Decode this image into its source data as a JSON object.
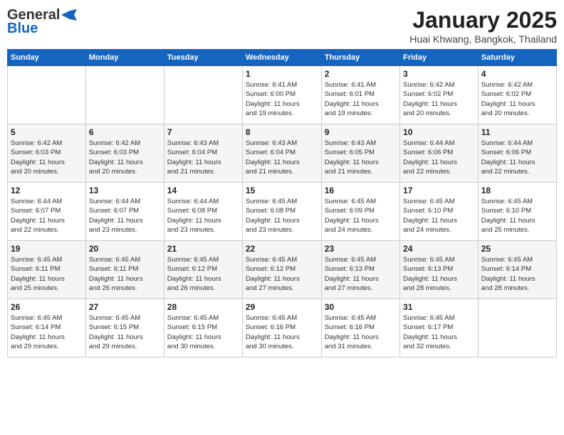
{
  "header": {
    "logo_general": "General",
    "logo_blue": "Blue",
    "title": "January 2025",
    "subtitle": "Huai Khwang, Bangkok, Thailand"
  },
  "weekdays": [
    "Sunday",
    "Monday",
    "Tuesday",
    "Wednesday",
    "Thursday",
    "Friday",
    "Saturday"
  ],
  "weeks": [
    [
      {
        "day": "",
        "info": ""
      },
      {
        "day": "",
        "info": ""
      },
      {
        "day": "",
        "info": ""
      },
      {
        "day": "1",
        "info": "Sunrise: 6:41 AM\nSunset: 6:00 PM\nDaylight: 11 hours\nand 19 minutes."
      },
      {
        "day": "2",
        "info": "Sunrise: 6:41 AM\nSunset: 6:01 PM\nDaylight: 11 hours\nand 19 minutes."
      },
      {
        "day": "3",
        "info": "Sunrise: 6:42 AM\nSunset: 6:02 PM\nDaylight: 11 hours\nand 20 minutes."
      },
      {
        "day": "4",
        "info": "Sunrise: 6:42 AM\nSunset: 6:02 PM\nDaylight: 11 hours\nand 20 minutes."
      }
    ],
    [
      {
        "day": "5",
        "info": "Sunrise: 6:42 AM\nSunset: 6:03 PM\nDaylight: 11 hours\nand 20 minutes."
      },
      {
        "day": "6",
        "info": "Sunrise: 6:42 AM\nSunset: 6:03 PM\nDaylight: 11 hours\nand 20 minutes."
      },
      {
        "day": "7",
        "info": "Sunrise: 6:43 AM\nSunset: 6:04 PM\nDaylight: 11 hours\nand 21 minutes."
      },
      {
        "day": "8",
        "info": "Sunrise: 6:43 AM\nSunset: 6:04 PM\nDaylight: 11 hours\nand 21 minutes."
      },
      {
        "day": "9",
        "info": "Sunrise: 6:43 AM\nSunset: 6:05 PM\nDaylight: 11 hours\nand 21 minutes."
      },
      {
        "day": "10",
        "info": "Sunrise: 6:44 AM\nSunset: 6:06 PM\nDaylight: 11 hours\nand 22 minutes."
      },
      {
        "day": "11",
        "info": "Sunrise: 6:44 AM\nSunset: 6:06 PM\nDaylight: 11 hours\nand 22 minutes."
      }
    ],
    [
      {
        "day": "12",
        "info": "Sunrise: 6:44 AM\nSunset: 6:07 PM\nDaylight: 11 hours\nand 22 minutes."
      },
      {
        "day": "13",
        "info": "Sunrise: 6:44 AM\nSunset: 6:07 PM\nDaylight: 11 hours\nand 23 minutes."
      },
      {
        "day": "14",
        "info": "Sunrise: 6:44 AM\nSunset: 6:08 PM\nDaylight: 11 hours\nand 23 minutes."
      },
      {
        "day": "15",
        "info": "Sunrise: 6:45 AM\nSunset: 6:08 PM\nDaylight: 11 hours\nand 23 minutes."
      },
      {
        "day": "16",
        "info": "Sunrise: 6:45 AM\nSunset: 6:09 PM\nDaylight: 11 hours\nand 24 minutes."
      },
      {
        "day": "17",
        "info": "Sunrise: 6:45 AM\nSunset: 6:10 PM\nDaylight: 11 hours\nand 24 minutes."
      },
      {
        "day": "18",
        "info": "Sunrise: 6:45 AM\nSunset: 6:10 PM\nDaylight: 11 hours\nand 25 minutes."
      }
    ],
    [
      {
        "day": "19",
        "info": "Sunrise: 6:45 AM\nSunset: 6:11 PM\nDaylight: 11 hours\nand 25 minutes."
      },
      {
        "day": "20",
        "info": "Sunrise: 6:45 AM\nSunset: 6:11 PM\nDaylight: 11 hours\nand 26 minutes."
      },
      {
        "day": "21",
        "info": "Sunrise: 6:45 AM\nSunset: 6:12 PM\nDaylight: 11 hours\nand 26 minutes."
      },
      {
        "day": "22",
        "info": "Sunrise: 6:45 AM\nSunset: 6:12 PM\nDaylight: 11 hours\nand 27 minutes."
      },
      {
        "day": "23",
        "info": "Sunrise: 6:45 AM\nSunset: 6:13 PM\nDaylight: 11 hours\nand 27 minutes."
      },
      {
        "day": "24",
        "info": "Sunrise: 6:45 AM\nSunset: 6:13 PM\nDaylight: 11 hours\nand 28 minutes."
      },
      {
        "day": "25",
        "info": "Sunrise: 6:45 AM\nSunset: 6:14 PM\nDaylight: 11 hours\nand 28 minutes."
      }
    ],
    [
      {
        "day": "26",
        "info": "Sunrise: 6:45 AM\nSunset: 6:14 PM\nDaylight: 11 hours\nand 29 minutes."
      },
      {
        "day": "27",
        "info": "Sunrise: 6:45 AM\nSunset: 6:15 PM\nDaylight: 11 hours\nand 29 minutes."
      },
      {
        "day": "28",
        "info": "Sunrise: 6:45 AM\nSunset: 6:15 PM\nDaylight: 11 hours\nand 30 minutes."
      },
      {
        "day": "29",
        "info": "Sunrise: 6:45 AM\nSunset: 6:16 PM\nDaylight: 11 hours\nand 30 minutes."
      },
      {
        "day": "30",
        "info": "Sunrise: 6:45 AM\nSunset: 6:16 PM\nDaylight: 11 hours\nand 31 minutes."
      },
      {
        "day": "31",
        "info": "Sunrise: 6:45 AM\nSunset: 6:17 PM\nDaylight: 11 hours\nand 32 minutes."
      },
      {
        "day": "",
        "info": ""
      }
    ]
  ]
}
